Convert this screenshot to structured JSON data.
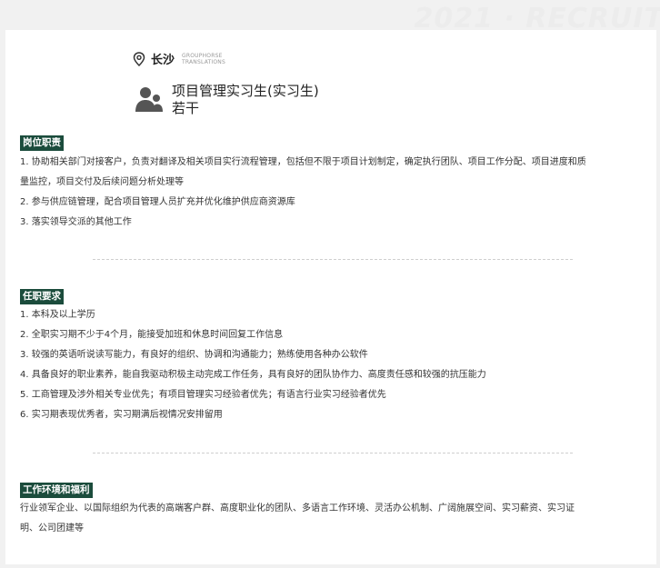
{
  "watermark": "2021 · RECRUIT",
  "location": {
    "city": "长沙",
    "brand_line1": "GROUPHORSE",
    "brand_line2": "TRANSLATIONS"
  },
  "job": {
    "title": "项目管理实习生(实习生)",
    "headcount": "若干"
  },
  "sections": {
    "duties": {
      "heading": "岗位职责",
      "items": [
        "1. 协助相关部门对接客户，负责对翻译及相关项目实行流程管理，包括但不限于项目计划制定，确定执行团队、项目工作分配、项目进度和质",
        "量监控，项目交付及后续问题分析处理等",
        "2. 参与供应链管理，配合项目管理人员扩充并优化维护供应商资源库",
        "3. 落实领导交派的其他工作"
      ]
    },
    "requirements": {
      "heading": "任职要求",
      "items": [
        "1. 本科及以上学历",
        "2. 全职实习期不少于4个月，能接受加班和休息时间回复工作信息",
        "3. 较强的英语听说读写能力，有良好的组织、协调和沟通能力；熟练使用各种办公软件",
        "4. 具备良好的职业素养，能自我驱动积极主动完成工作任务，具有良好的团队协作力、高度责任感和较强的抗压能力",
        "5. 工商管理及涉外相关专业优先；有项目管理实习经验者优先；有语言行业实习经验者优先",
        "6. 实习期表现优秀者，实习期满后视情况安排留用"
      ]
    },
    "benefits": {
      "heading": "工作环境和福利",
      "items": [
        "行业领军企业、以国际组织为代表的高端客户群、高度职业化的团队、多语言工作环境、灵活办公机制、广阔施展空间、实习薪资、实习证",
        "明、公司团建等"
      ]
    }
  },
  "icons": {
    "location": "map-pin-icon",
    "person": "people-icon"
  },
  "colors": {
    "accent": "#1b4c3c",
    "text": "#333333",
    "page_bg": "#f1f1f1",
    "card_bg": "#ffffff",
    "icon": "#555555"
  }
}
